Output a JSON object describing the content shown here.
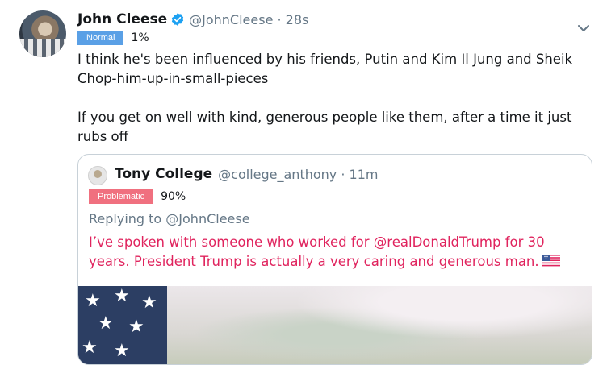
{
  "tweet": {
    "name": "John Cleese",
    "handle": "@JohnCleese · 28s",
    "badge": "Normal",
    "percent": "1%",
    "text": "I think he's been influenced by his friends, Putin and Kim Il Jung and Sheik Chop-him-up-in-small-pieces\n\nIf you get on well with kind, generous people like them, after a time it just rubs off"
  },
  "quoted": {
    "name": "Tony College",
    "handle": "@college_anthony · 11m",
    "badge": "Problematic",
    "percent": "90%",
    "reply_prefix": "Replying to ",
    "reply_mention": "@JohnCleese",
    "text": "I’ve spoken with someone who worked for @realDonaldTrump for 30 years. President Trump is actually a very caring and generous man."
  },
  "icons": {
    "verified": "verified-badge-icon",
    "chevron": "chevron-down-icon",
    "flag": "us-flag-icon"
  },
  "colors": {
    "normal_badge": "#5aa0e6",
    "problematic_badge": "#f0707f",
    "quoted_text": "#e0245e",
    "verified": "#1da1f2"
  }
}
